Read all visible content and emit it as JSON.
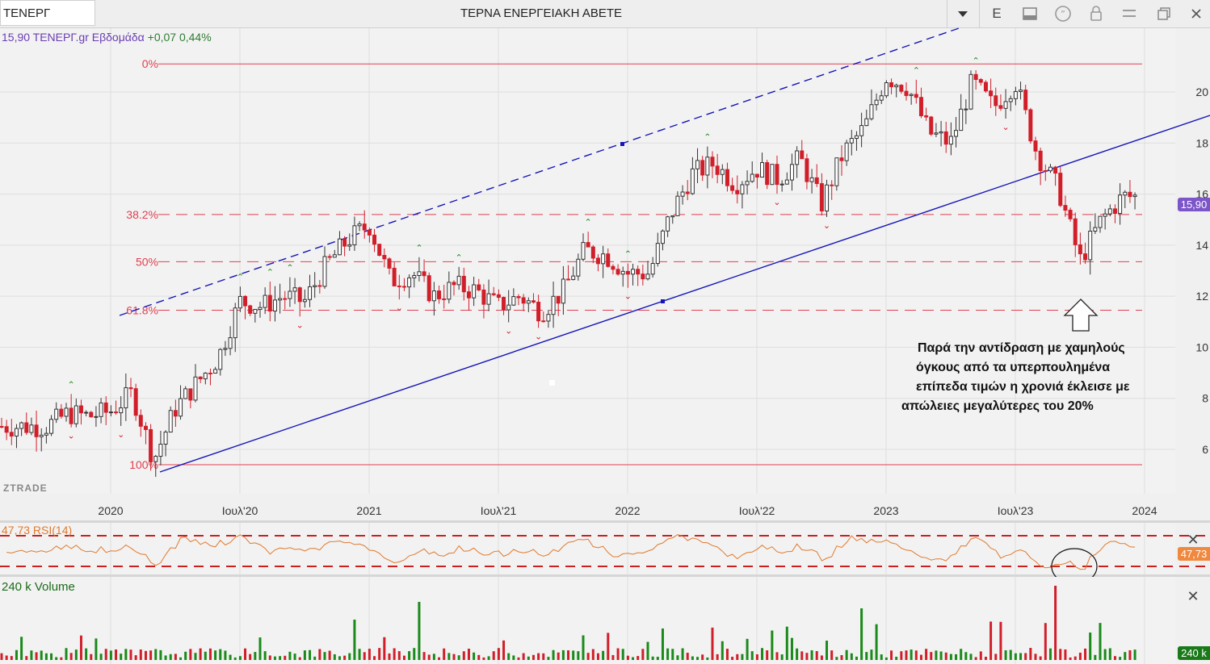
{
  "toolbar": {
    "symbol": "ΤΕΝΕΡΓ",
    "title": "ΤΕΡΝΑ ΕΝΕΡΓΕΙΑΚΗ ΑΒΕΤΕ",
    "period_button": "E"
  },
  "legend": {
    "text": "15,90 ΤΕΝΕΡΓ.gr Εβδομάδα",
    "change": "+0,07 0,44%"
  },
  "price_badge": "15,90",
  "rsi": {
    "label": "47,73 RSI(14)",
    "badge": "47,73"
  },
  "volume": {
    "label": "240 k Volume",
    "badge": "240 k"
  },
  "watermark": "ZTRADE",
  "note": [
    "Παρά την αντίδραση με χαμηλούς",
    "όγκους από τα υπερπουλημένα",
    "επίπεδα τιμών η χρονιά έκλεισε με",
    "απώλειες μεγαλύτερες του 20%"
  ],
  "chart_data": {
    "type": "candlestick",
    "timeframe": "Εβδομάδα",
    "x_ticks": [
      "2020",
      "Ιουλ'20",
      "2021",
      "Ιουλ'21",
      "2022",
      "Ιουλ'22",
      "2023",
      "Ιουλ'23",
      "2024"
    ],
    "y_ticks": [
      6,
      8,
      10,
      12,
      14,
      16,
      18,
      20
    ],
    "y_range": [
      4.5,
      21.5
    ],
    "fibonacci_levels": [
      {
        "label": "0%",
        "value": 21.1
      },
      {
        "label": "38.2%",
        "value": 15.2
      },
      {
        "label": "50%",
        "value": 13.35
      },
      {
        "label": "61.8%",
        "value": 11.45
      },
      {
        "label": "100%",
        "value": 5.4
      }
    ],
    "series_close_approx": [
      [
        "2019-10",
        6.9
      ],
      [
        "2019-11",
        7.4
      ],
      [
        "2019-12",
        7.3
      ],
      [
        "2020-01",
        7.5
      ],
      [
        "2020-02",
        8.2
      ],
      [
        "2020-03",
        5.6
      ],
      [
        "2020-04",
        7.6
      ],
      [
        "2020-05",
        8.6
      ],
      [
        "2020-06",
        9.6
      ],
      [
        "2020-07",
        11.8
      ],
      [
        "2020-08",
        11.6
      ],
      [
        "2020-09",
        12.0
      ],
      [
        "2020-10",
        11.8
      ],
      [
        "2020-11",
        13.2
      ],
      [
        "2020-12",
        14.2
      ],
      [
        "2021-01",
        14.8
      ],
      [
        "2021-02",
        12.6
      ],
      [
        "2021-03",
        12.9
      ],
      [
        "2021-04",
        12.0
      ],
      [
        "2021-05",
        12.4
      ],
      [
        "2021-06",
        12.2
      ],
      [
        "2021-07",
        11.6
      ],
      [
        "2021-08",
        12.0
      ],
      [
        "2021-09",
        11.4
      ],
      [
        "2021-10",
        12.2
      ],
      [
        "2021-11",
        13.8
      ],
      [
        "2021-12",
        13.6
      ],
      [
        "2022-01",
        12.9
      ],
      [
        "2022-02",
        12.9
      ],
      [
        "2022-03",
        15.2
      ],
      [
        "2022-04",
        16.8
      ],
      [
        "2022-05",
        17.2
      ],
      [
        "2022-06",
        16.4
      ],
      [
        "2022-07",
        17.0
      ],
      [
        "2022-08",
        16.6
      ],
      [
        "2022-09",
        17.4
      ],
      [
        "2022-10",
        15.6
      ],
      [
        "2022-11",
        17.6
      ],
      [
        "2022-12",
        18.6
      ],
      [
        "2023-01",
        20.6
      ],
      [
        "2023-02",
        20.2
      ],
      [
        "2023-03",
        18.4
      ],
      [
        "2023-04",
        18.0
      ],
      [
        "2023-05",
        20.4
      ],
      [
        "2023-06",
        19.4
      ],
      [
        "2023-07",
        20.4
      ],
      [
        "2023-08",
        17.6
      ],
      [
        "2023-09",
        16.2
      ],
      [
        "2023-10",
        13.4
      ],
      [
        "2023-11",
        15.0
      ],
      [
        "2023-12",
        15.9
      ]
    ],
    "rsi_period": 14,
    "rsi_last": 47.73,
    "volume_last": "240 k"
  },
  "colors": {
    "up": "#333333",
    "down": "#d11f2a",
    "channel": "#1515b8",
    "fib": "#e04050",
    "rsi": "#e07a2e",
    "volume_up": "#1a8a1a",
    "volume_down": "#d11f2a"
  }
}
